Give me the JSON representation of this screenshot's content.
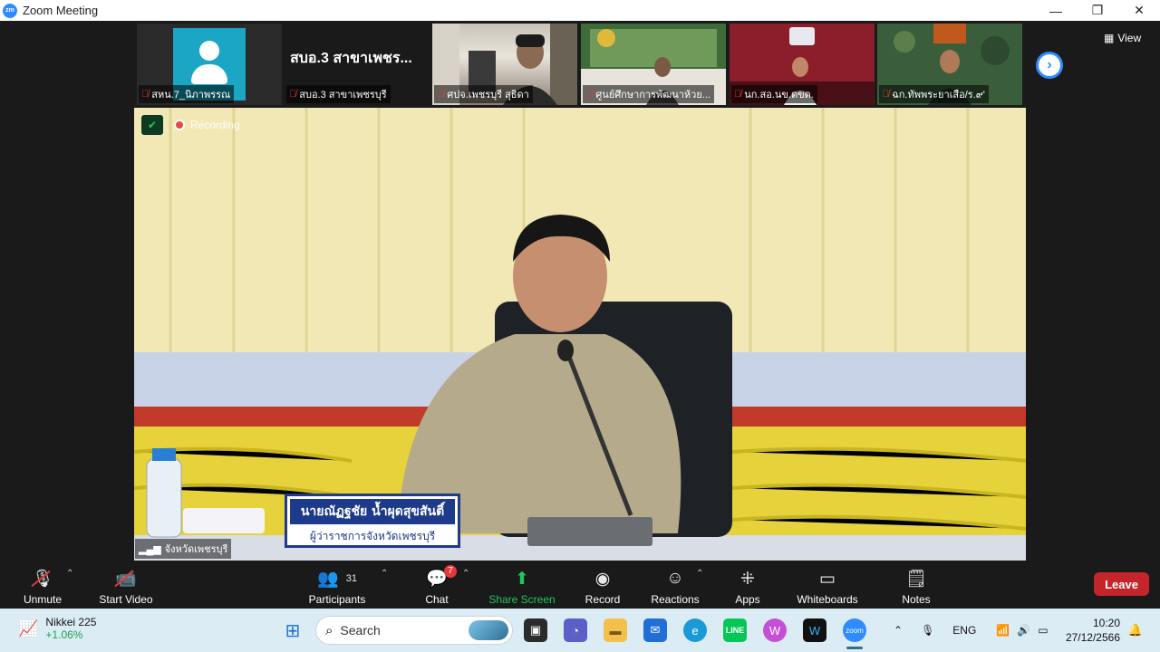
{
  "window": {
    "logo_text": "zm",
    "title": "Zoom Meeting",
    "minimize": "—",
    "maximize": "❐",
    "close": "✕"
  },
  "top_bar": {
    "view_label": "View",
    "next_arrow": "›"
  },
  "thumbnails": [
    {
      "name": "สหน.7_นิภาพรรณ",
      "type": "avatar"
    },
    {
      "name": "สบอ.3 สาขาเพชรบุรี",
      "big_text": "สบอ.3 สาขาเพชร...",
      "type": "text"
    },
    {
      "name": "ศปจ.เพชรบุรี สุธิดา",
      "type": "video"
    },
    {
      "name": "ศูนย์ศึกษาการพัฒนาห้วย...",
      "type": "video"
    },
    {
      "name": "นก.สอ.นข.ดขด.",
      "type": "video"
    },
    {
      "name": "ฉก.ทัพพระยาเสือ/ร.๙'",
      "type": "video"
    }
  ],
  "main_video": {
    "recording_label": "Recording",
    "participant_name": "จังหวัดเพชรบุรี",
    "nameplate_name": "นายณัฏฐชัย น้ำผุดสุขสันติ์",
    "nameplate_title": "ผู้ว่าราชการจังหวัดเพชรบุรี"
  },
  "toolbar": {
    "unmute": "Unmute",
    "start_video": "Start Video",
    "participants": "Participants",
    "participants_count": "31",
    "chat": "Chat",
    "chat_badge": "7",
    "share_screen": "Share Screen",
    "record": "Record",
    "reactions": "Reactions",
    "apps": "Apps",
    "whiteboards": "Whiteboards",
    "notes": "Notes",
    "leave": "Leave"
  },
  "taskbar": {
    "stock_name": "Nikkei 225",
    "stock_change": "+1.06%",
    "search_placeholder": "Search",
    "language": "ENG",
    "time": "10:20",
    "date": "27/12/2566"
  },
  "colors": {
    "accent": "#2d8cff",
    "leave": "#c4252a",
    "share_green": "#22c55e",
    "recording_red": "#e5383b"
  }
}
